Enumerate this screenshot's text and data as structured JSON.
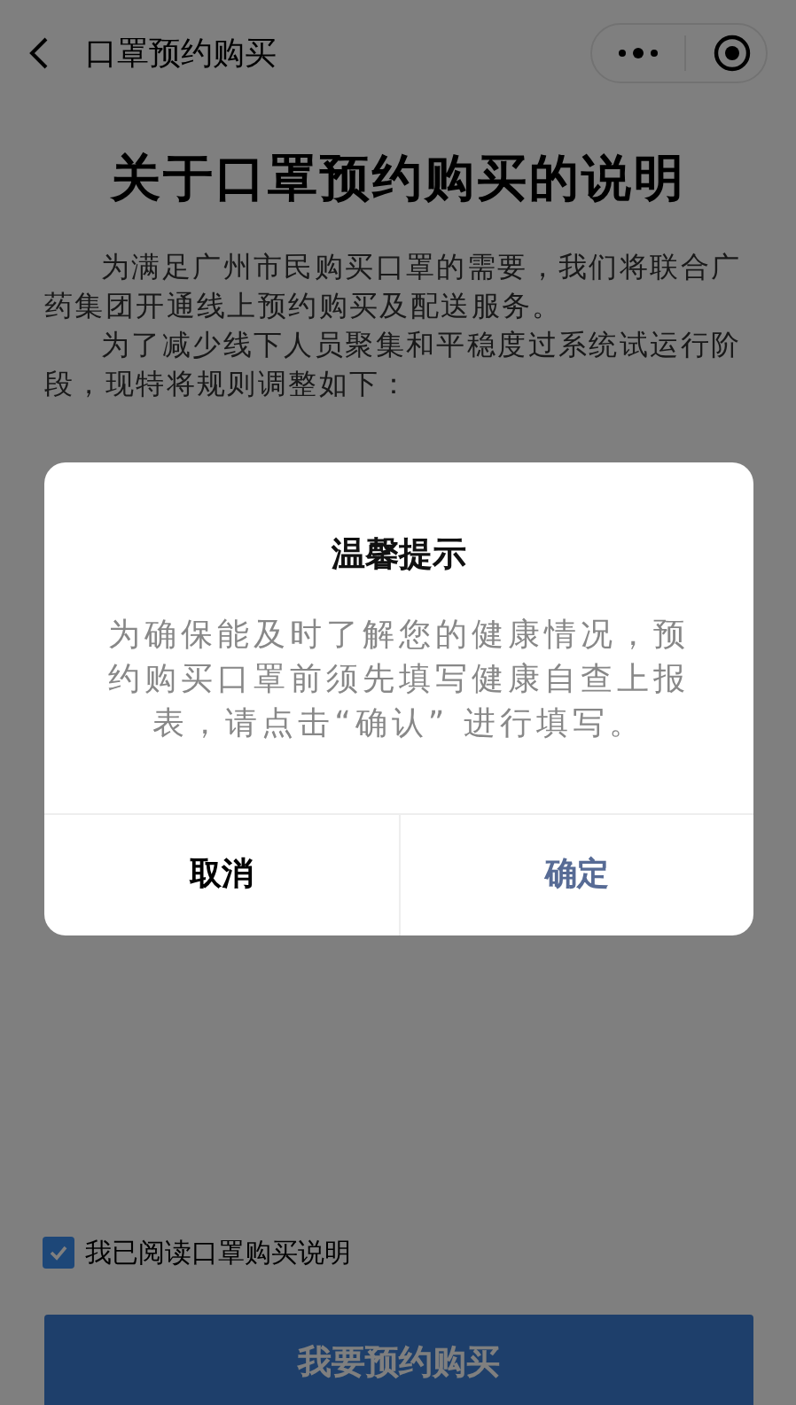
{
  "nav_bar": {
    "title": "口罩预约购买"
  },
  "page": {
    "heading": "关于口罩预约购买的说明",
    "paragraphs": [
      "为满足广州市民购买口罩的需要，我们将联合广药集团开通线上预约购买及配送服务。",
      "为了减少线下人员聚集和平稳度过系统试运行阶段，现特将规则调整如下："
    ],
    "agreement": {
      "label": "我已阅读口罩购买说明",
      "checked": true
    },
    "submit_button": "我要预约购买"
  },
  "dialog": {
    "title": "温馨提示",
    "message": "为确保能及时了解您的健康情况，预约购买口罩前须先填写健康自查上报表，请点击“确认” 进行填写。",
    "buttons": [
      {
        "label": "取消",
        "kind": "cancel"
      },
      {
        "label": "确定",
        "kind": "confirm"
      }
    ]
  }
}
